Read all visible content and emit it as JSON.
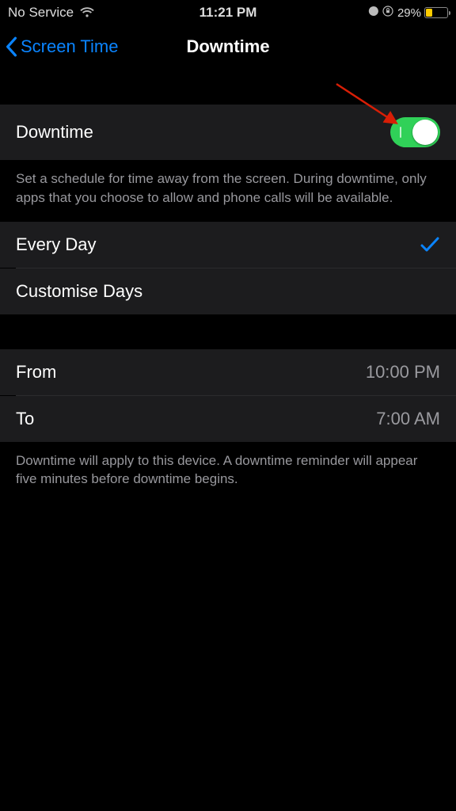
{
  "status": {
    "carrier": "No Service",
    "time": "11:21 PM",
    "battery_pct": "29%"
  },
  "nav": {
    "back_label": "Screen Time",
    "title": "Downtime"
  },
  "toggle": {
    "label": "Downtime",
    "on": true,
    "color_on": "#30d158"
  },
  "description": "Set a schedule for time away from the screen. During downtime, only apps that you choose to allow and phone calls will be available.",
  "schedule_mode": {
    "every_day": "Every Day",
    "customise": "Customise Days",
    "selected": "every_day"
  },
  "time_range": {
    "from_label": "From",
    "from_value": "10:00 PM",
    "to_label": "To",
    "to_value": "7:00 AM"
  },
  "footer_note": "Downtime will apply to this device. A downtime reminder will appear five minutes before downtime begins.",
  "colors": {
    "accent": "#0a84ff",
    "toggle_on": "#30d158",
    "battery_low": "#ffcc00",
    "annotation_arrow": "#d81e06"
  }
}
